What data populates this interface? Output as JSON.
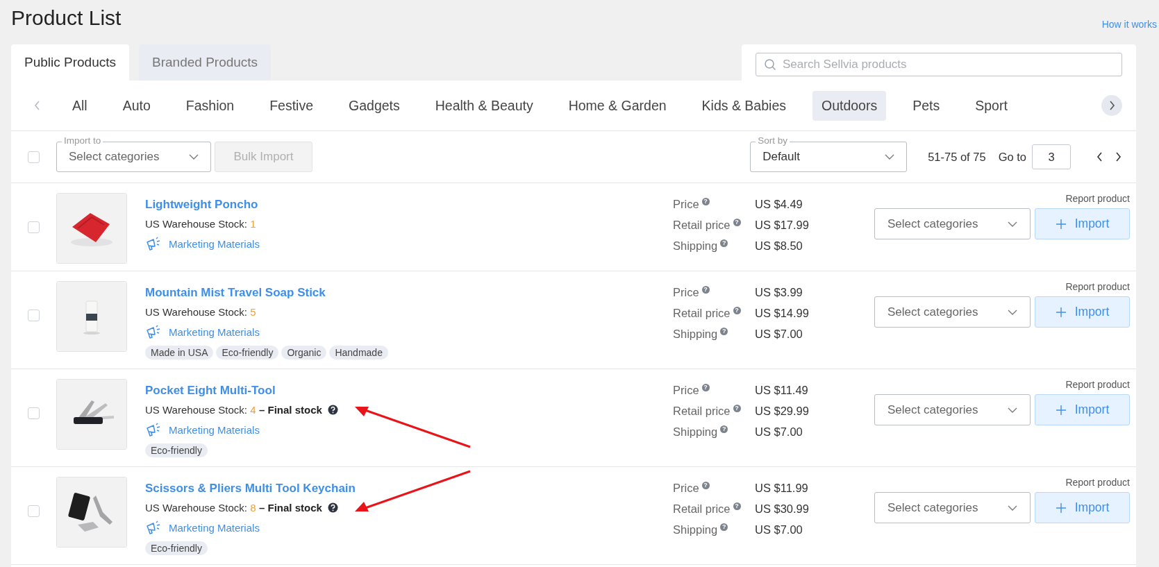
{
  "page": {
    "title": "Product List",
    "help_link": "How it works"
  },
  "tabs": [
    {
      "label": "Public Products",
      "selected": true
    },
    {
      "label": "Branded Products",
      "selected": false
    }
  ],
  "search": {
    "placeholder": "Search Sellvia products"
  },
  "categories": [
    {
      "label": "All",
      "selected": false
    },
    {
      "label": "Auto",
      "selected": false
    },
    {
      "label": "Fashion",
      "selected": false
    },
    {
      "label": "Festive",
      "selected": false
    },
    {
      "label": "Gadgets",
      "selected": false
    },
    {
      "label": "Health & Beauty",
      "selected": false
    },
    {
      "label": "Home & Garden",
      "selected": false
    },
    {
      "label": "Kids & Babies",
      "selected": false
    },
    {
      "label": "Outdoors",
      "selected": true
    },
    {
      "label": "Pets",
      "selected": false
    },
    {
      "label": "Sport",
      "selected": false
    }
  ],
  "toolbar": {
    "select_all_checked": false,
    "import_to": {
      "label": "Import to",
      "placeholder": "Select categories"
    },
    "bulk_import": {
      "label": "Bulk Import",
      "disabled": true
    },
    "sort_by": {
      "label": "Sort by",
      "value": "Default"
    },
    "range": "51-75 of 75",
    "go_to_label": "Go to",
    "page": "3"
  },
  "products": [
    {
      "name": "Lightweight Poncho",
      "checked": false,
      "image": {
        "kind": "picture"
      },
      "stock_label": "US Warehouse Stock:",
      "stock": "1",
      "highlighted": false,
      "marketing": "Marketing Materials",
      "price_label": "Price",
      "price": "US $4.49",
      "retail_label": "Retail price",
      "retail": "US $17.99",
      "shipping_label": "Shipping",
      "shipping": "US $8.50",
      "help_mark": "?",
      "report": "Report product",
      "select_placeholder": "Select categories",
      "import": "Import"
    },
    {
      "name": "Mountain Mist Travel Soap Stick",
      "checked": false,
      "image": {
        "kind": "picture"
      },
      "stock_label": "US Warehouse Stock:",
      "stock": "5",
      "highlighted": false,
      "marketing": "Marketing Materials",
      "tags": [
        "Made in USA",
        "Eco-friendly",
        "Organic",
        "Handmade"
      ],
      "price_label": "Price",
      "price": "US $3.99",
      "retail_label": "Retail price",
      "retail": "US $14.99",
      "shipping_label": "Shipping",
      "shipping": "US $7.00",
      "help_mark": "?",
      "report": "Report product",
      "select_placeholder": "Select categories",
      "import": "Import"
    },
    {
      "name": "Pocket Eight Multi-Tool",
      "checked": false,
      "image": {
        "kind": "picture"
      },
      "stock_label": "US Warehouse Stock:",
      "stock": "4",
      "final_stock": "– Final stock",
      "highlighted": true,
      "marketing": "Marketing Materials",
      "tags": [
        "Eco-friendly"
      ],
      "price_label": "Price",
      "price": "US $11.49",
      "retail_label": "Retail price",
      "retail": "US $29.99",
      "shipping_label": "Shipping",
      "shipping": "US $7.00",
      "help_mark": "?",
      "report": "Report product",
      "select_placeholder": "Select categories",
      "import": "Import"
    },
    {
      "name": "Scissors & Pliers Multi Tool Keychain",
      "checked": false,
      "image": {
        "kind": "picture"
      },
      "stock_label": "US Warehouse Stock:",
      "stock": "8",
      "final_stock": "– Final stock",
      "highlighted": true,
      "marketing": "Marketing Materials",
      "tags": [
        "Eco-friendly"
      ],
      "price_label": "Price",
      "price": "US $11.99",
      "retail_label": "Retail price",
      "retail": "US $30.99",
      "shipping_label": "Shipping",
      "shipping": "US $7.00",
      "help_mark": "?",
      "report": "Report product",
      "select_placeholder": "Select categories",
      "import": "Import"
    }
  ]
}
